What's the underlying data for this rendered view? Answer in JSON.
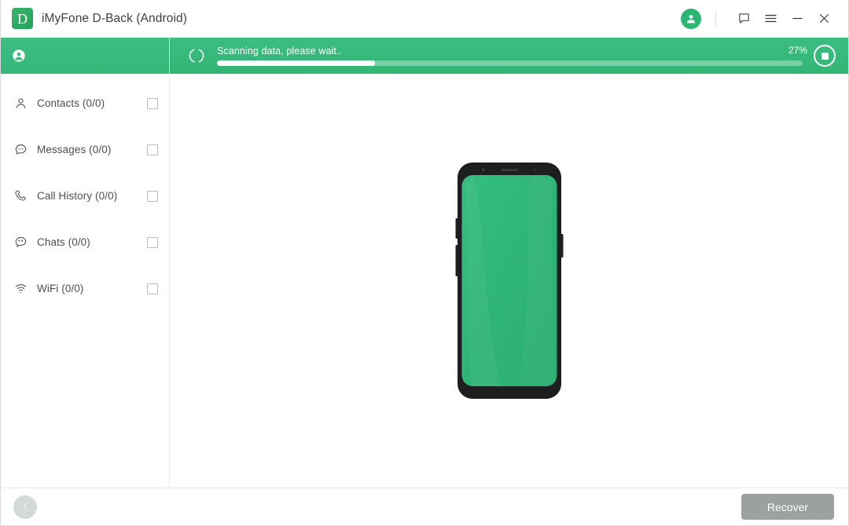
{
  "window": {
    "title": "iMyFone D-Back (Android)",
    "logo_letter": "D",
    "accent_green": "#33b575",
    "titlebar_icons": {
      "account": "account-circle-icon",
      "feedback": "feedback-chat-icon",
      "menu": "hamburger-menu-icon",
      "minimize": "minimize-icon",
      "close": "close-icon"
    }
  },
  "sidebar": {
    "device": {
      "icon": "user-circle-icon",
      "name_redacted": true,
      "name": ""
    },
    "items": [
      {
        "icon": "contact-person-icon",
        "label": "Contacts (0/0)",
        "checked": false
      },
      {
        "icon": "message-bubble-icon",
        "label": "Messages (0/0)",
        "checked": false
      },
      {
        "icon": "phone-handset-icon",
        "label": "Call History (0/0)",
        "checked": false
      },
      {
        "icon": "chats-bubble-icon",
        "label": "Chats (0/0)",
        "checked": false
      },
      {
        "icon": "wifi-icon",
        "label": "WiFi (0/0)",
        "checked": false
      }
    ]
  },
  "scan": {
    "status_text": "Scanning data, please wait..",
    "percent_label": "27%",
    "percent_value": 27,
    "spinner": "loading-spinner-icon",
    "stop_button": "stop-scan-button"
  },
  "main": {
    "illustration": "android-phone-illustration",
    "phone_screen_color": "#2fb577"
  },
  "footer": {
    "back_button": "back-chevron-button",
    "recover_label": "Recover",
    "recover_enabled": false
  }
}
